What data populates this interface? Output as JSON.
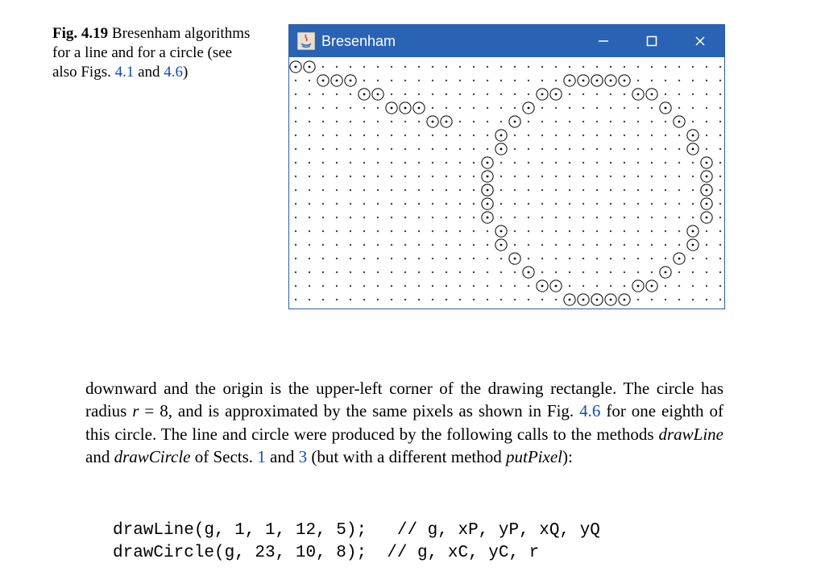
{
  "caption": {
    "fignum": "Fig. 4.19",
    "text1": "   Bresenham algorithms for a line and for a circle (see also Figs. ",
    "link1": "4.1",
    "mid": " and ",
    "link2": "4.6",
    "tail": ")"
  },
  "window": {
    "title": "Bresenham",
    "icon_name": "java-icon",
    "min_label": "Minimize",
    "max_label": "Maximize",
    "close_label": "Close"
  },
  "bresenham": {
    "grid": {
      "cols": 33,
      "rows": 19,
      "cell": 17
    },
    "line": {
      "xP": 0,
      "yP": 0,
      "xQ": 11,
      "yQ": 4
    },
    "circle": {
      "xC": 22,
      "yC": 9,
      "r": 8
    }
  },
  "body": {
    "p": {
      "t1": "downward and the origin is the upper-left corner of the drawing rectangle. The circle has radius ",
      "math_r": "r",
      "t2": " = 8, and is approximated by the same pixels as shown in Fig. ",
      "link46": "4.6",
      "t3": " for one eighth of this circle. The line and circle were produced by the following calls to the methods ",
      "m_drawLine": "drawLine",
      "t4": " and ",
      "m_drawCircle": "drawCircle",
      "t5": " of Sects. ",
      "link_s1": "1",
      "t6": " and ",
      "link_s3": "3",
      "t7": " (but with a different method ",
      "m_putPixel": "putPixel",
      "t8": "):"
    }
  },
  "code": {
    "l1": "drawLine(g, 1, 1, 12, 5);   // g, xP, yP, xQ, yQ",
    "l2": "drawCircle(g, 23, 10, 8);  // g, xC, yC, r"
  }
}
